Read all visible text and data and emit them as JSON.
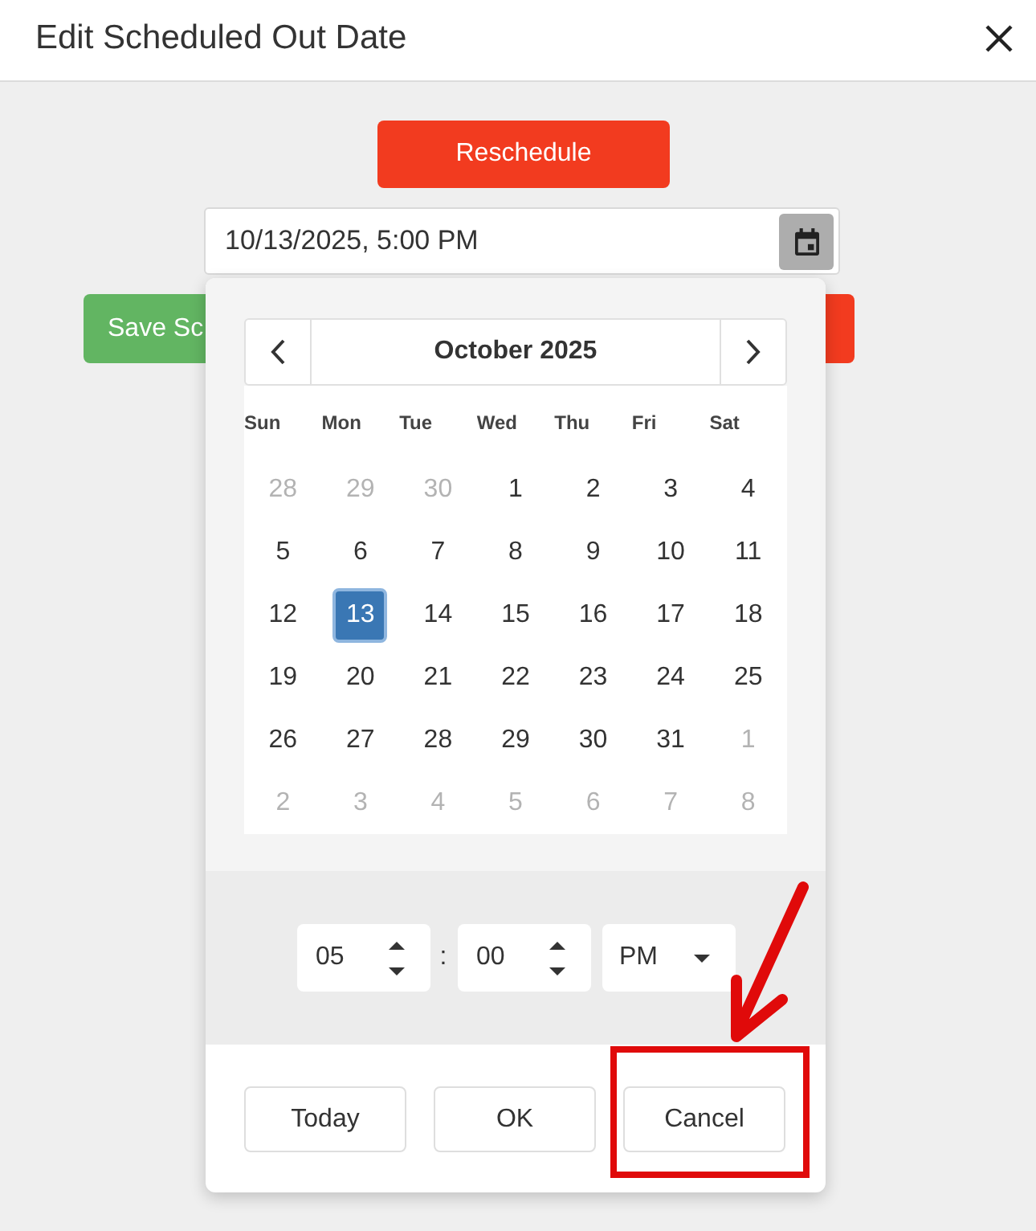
{
  "dialog": {
    "title": "Edit Scheduled Out Date"
  },
  "form": {
    "reschedule_button": "Reschedule",
    "datetime_field": {
      "value": "10/13/2025, 5:00 PM"
    },
    "actions": [
      {
        "kind": "success",
        "label": "Save Sc"
      },
      {
        "kind": "danger"
      }
    ]
  },
  "picker": {
    "month_title": "October 2025",
    "weekdays": [
      "Sun",
      "Mon",
      "Tue",
      "Wed",
      "Thu",
      "Fri",
      "Sat"
    ],
    "weeks": [
      [
        {
          "label": "28",
          "selected": false,
          "outside": true
        },
        {
          "label": "29",
          "selected": false,
          "outside": true
        },
        {
          "label": "30",
          "selected": false,
          "outside": true
        },
        {
          "label": "1",
          "selected": false,
          "outside": false
        },
        {
          "label": "2",
          "selected": false,
          "outside": false
        },
        {
          "label": "3",
          "selected": false,
          "outside": false
        },
        {
          "label": "4",
          "selected": false,
          "outside": false
        }
      ],
      [
        {
          "label": "5",
          "selected": false,
          "outside": false
        },
        {
          "label": "6",
          "selected": false,
          "outside": false
        },
        {
          "label": "7",
          "selected": false,
          "outside": false
        },
        {
          "label": "8",
          "selected": false,
          "outside": false
        },
        {
          "label": "9",
          "selected": false,
          "outside": false
        },
        {
          "label": "10",
          "selected": false,
          "outside": false
        },
        {
          "label": "11",
          "selected": false,
          "outside": false
        }
      ],
      [
        {
          "label": "12",
          "selected": false,
          "outside": false
        },
        {
          "label": "13",
          "selected": true,
          "outside": false
        },
        {
          "label": "14",
          "selected": false,
          "outside": false
        },
        {
          "label": "15",
          "selected": false,
          "outside": false
        },
        {
          "label": "16",
          "selected": false,
          "outside": false
        },
        {
          "label": "17",
          "selected": false,
          "outside": false
        },
        {
          "label": "18",
          "selected": false,
          "outside": false
        }
      ],
      [
        {
          "label": "19",
          "selected": false,
          "outside": false
        },
        {
          "label": "20",
          "selected": false,
          "outside": false
        },
        {
          "label": "21",
          "selected": false,
          "outside": false
        },
        {
          "label": "22",
          "selected": false,
          "outside": false
        },
        {
          "label": "23",
          "selected": false,
          "outside": false
        },
        {
          "label": "24",
          "selected": false,
          "outside": false
        },
        {
          "label": "25",
          "selected": false,
          "outside": false
        }
      ],
      [
        {
          "label": "26",
          "selected": false,
          "outside": false
        },
        {
          "label": "27",
          "selected": false,
          "outside": false
        },
        {
          "label": "28",
          "selected": false,
          "outside": false
        },
        {
          "label": "29",
          "selected": false,
          "outside": false
        },
        {
          "label": "30",
          "selected": false,
          "outside": false
        },
        {
          "label": "31",
          "selected": false,
          "outside": false
        },
        {
          "label": "1",
          "selected": false,
          "outside": true
        }
      ],
      [
        {
          "label": "2",
          "selected": false,
          "outside": true
        },
        {
          "label": "3",
          "selected": false,
          "outside": true
        },
        {
          "label": "4",
          "selected": false,
          "outside": true
        },
        {
          "label": "5",
          "selected": false,
          "outside": true
        },
        {
          "label": "6",
          "selected": false,
          "outside": true
        },
        {
          "label": "7",
          "selected": false,
          "outside": true
        },
        {
          "label": "8",
          "selected": false,
          "outside": true
        }
      ]
    ],
    "time": [
      {
        "kind": "spinner",
        "value": "05"
      },
      {
        "kind": "separator",
        "value": ":"
      },
      {
        "kind": "spinner",
        "value": "00"
      },
      {
        "kind": "dropdown",
        "value": "PM"
      }
    ],
    "buttons": [
      "Today",
      "OK",
      "Cancel"
    ]
  },
  "annotation": {
    "kind": "callout"
  }
}
